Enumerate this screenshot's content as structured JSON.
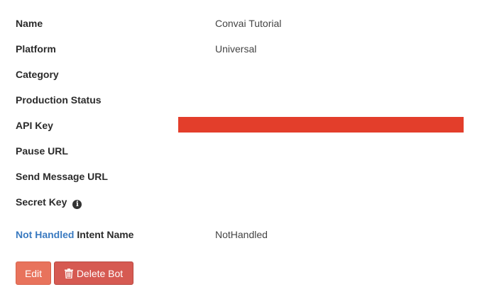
{
  "fields": [
    {
      "label": "Name",
      "value": "Convai Tutorial"
    },
    {
      "label": "Platform",
      "value": "Universal"
    },
    {
      "label": "Category",
      "value": ""
    },
    {
      "label": "Production Status",
      "value": ""
    },
    {
      "label": "API Key",
      "value": ""
    },
    {
      "label": "Pause URL",
      "value": ""
    },
    {
      "label": "Send Message URL",
      "value": ""
    },
    {
      "label": "Secret Key",
      "value": ""
    }
  ],
  "intent": {
    "link_text": "Not Handled",
    "label_suffix": " Intent Name",
    "value": "NotHandled"
  },
  "buttons": {
    "edit_label": "Edit",
    "delete_label": "Delete Bot"
  },
  "colors": {
    "redaction": "#e33e2b",
    "edit_button": "#e8735c",
    "delete_button": "#d65a52",
    "link": "#3a7ac0"
  },
  "icons": {
    "secret_key_info": "info-icon",
    "delete": "trash-icon"
  }
}
